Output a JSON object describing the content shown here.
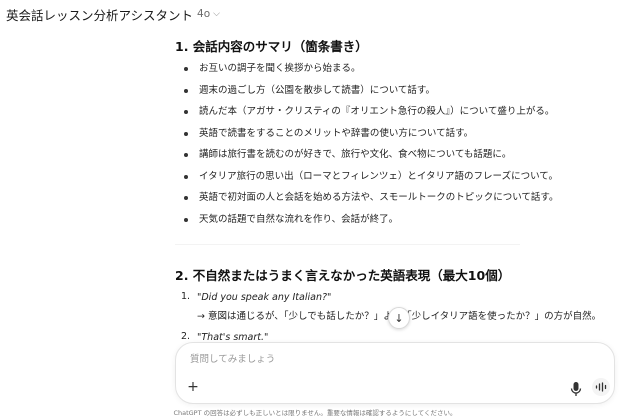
{
  "header": {
    "title": "英会話レッスン分析アシスタント",
    "model": "4o"
  },
  "section1": {
    "heading": "1. 会話内容のサマリ（箇条書き）",
    "bullets": [
      "お互いの調子を聞く挨拶から始まる。",
      "週末の過ごし方（公園を散歩して読書）について話す。",
      "読んだ本（アガサ・クリスティの『オリエント急行の殺人』）について盛り上がる。",
      "英語で読書をすることのメリットや辞書の使い方について話す。",
      "講師は旅行書を読むのが好きで、旅行や文化、食べ物についても話題に。",
      "イタリア旅行の思い出（ローマとフィレンツェ）とイタリア語のフレーズについて。",
      "英語で初対面の人と会話を始める方法や、スモールトークのトピックについて話す。",
      "天気の話題で自然な流れを作り、会話が終了。"
    ]
  },
  "section2": {
    "heading": "2. 不自然またはうまく言えなかった英語表現（最大10個）",
    "items": [
      {
        "num": "1.",
        "quote": "\"Did you speak any Italian?\"",
        "explanation": "→ 意図は通じるが、「少しでも話したか？」より「少しイタリア語を使ったか？」の方が自然。"
      },
      {
        "num": "2.",
        "quote": "\"That's smart.\""
      }
    ]
  },
  "composer": {
    "placeholder": "質問してみましょう"
  },
  "footer": {
    "disclaimer": "ChatGPT の回答は必ずしも正しいとは限りません。重要な情報は確認するようにしてください。"
  }
}
